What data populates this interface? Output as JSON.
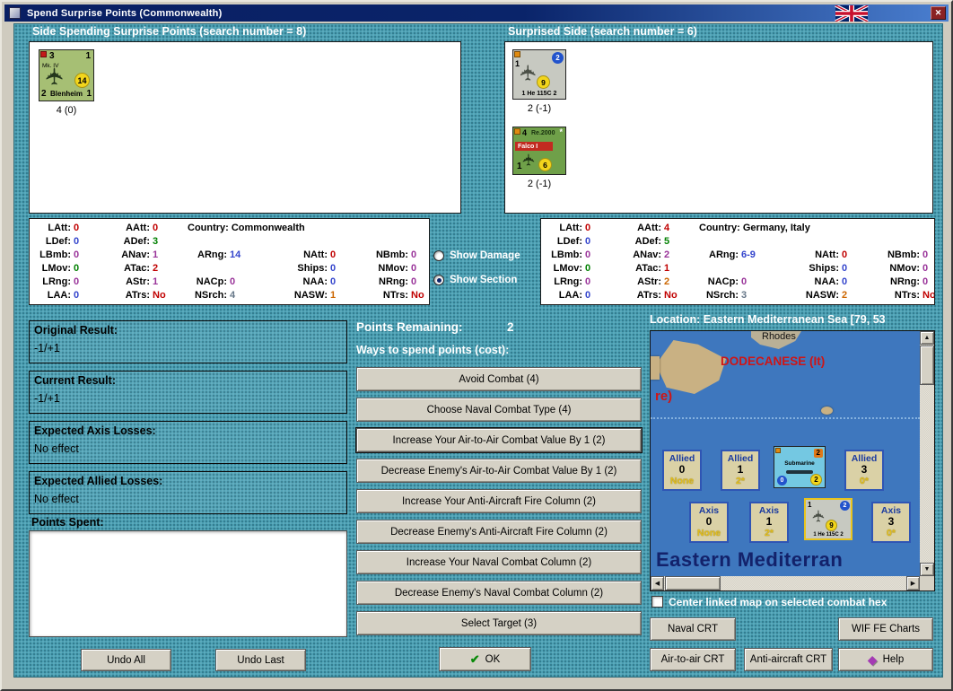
{
  "window": {
    "title": "Spend Surprise Points (Commonwealth)"
  },
  "icons": {
    "close": "✕",
    "up": "▲",
    "down": "▼",
    "left": "◀",
    "right": "▶",
    "check": "✔",
    "help_gem": "◆",
    "plane": "✈"
  },
  "left_panel": {
    "heading": "Side Spending Surprise Points (search number = 8)",
    "counter": {
      "tl": "3",
      "tr": "1",
      "variant": "Mk. IV",
      "rating": "14",
      "bl": "2",
      "name": "Blenheim",
      "br": "1",
      "caption": "4 (0)"
    }
  },
  "right_panel": {
    "heading": "Surprised Side (search number = 6)",
    "he115c": {
      "tl": "1",
      "badge": "2",
      "rating": "9",
      "label": "1 He 115C 2",
      "caption": "2 (-1)"
    },
    "re2000": {
      "tl": "4",
      "name": "Re.2000",
      "star": "*",
      "band": "Falco I",
      "bl": "1",
      "rating": "6",
      "caption": "2 (-1)"
    }
  },
  "spender_stats": {
    "rows": [
      [
        {
          "l": "LAtt:",
          "v": "0",
          "c": "#C00000"
        },
        {
          "l": "AAtt:",
          "v": "0",
          "c": "#C00000"
        },
        {
          "l": "Country:",
          "v": "Commonwealth",
          "c": "#000000",
          "span": 3,
          "country": true
        }
      ],
      [
        {
          "l": "LDef:",
          "v": "0",
          "c": "#3344CC"
        },
        {
          "l": "ADef:",
          "v": "3",
          "c": "#008000"
        },
        null,
        null,
        null
      ],
      [
        {
          "l": "LBmb:",
          "v": "0",
          "c": "#993399"
        },
        {
          "l": "ANav:",
          "v": "1",
          "c": "#993399"
        },
        {
          "l": "ARng:",
          "v": "14",
          "c": "#3344CC"
        },
        {
          "l": "NAtt:",
          "v": "0",
          "c": "#C00000"
        },
        {
          "l": "NBmb:",
          "v": "0",
          "c": "#993399"
        }
      ],
      [
        {
          "l": "LMov:",
          "v": "0",
          "c": "#008000"
        },
        {
          "l": "ATac:",
          "v": "2",
          "c": "#C00000"
        },
        null,
        {
          "l": "Ships:",
          "v": "0",
          "c": "#3344CC"
        },
        {
          "l": "NMov:",
          "v": "0",
          "c": "#993399"
        }
      ],
      [
        {
          "l": "LRng:",
          "v": "0",
          "c": "#993399"
        },
        {
          "l": "AStr:",
          "v": "1",
          "c": "#993399"
        },
        {
          "l": "NACp:",
          "v": "0",
          "c": "#993399"
        },
        {
          "l": "NAA:",
          "v": "0",
          "c": "#3344CC"
        },
        {
          "l": "NRng:",
          "v": "0",
          "c": "#993399"
        }
      ],
      [
        {
          "l": "LAA:",
          "v": "0",
          "c": "#3344CC"
        },
        {
          "l": "ATrs:",
          "v": "No",
          "c": "#C00000"
        },
        {
          "l": "NSrch:",
          "v": "4",
          "c": "#667788"
        },
        {
          "l": "NASW:",
          "v": "1",
          "c": "#CC6600"
        },
        {
          "l": "NTrs:",
          "v": "No",
          "c": "#C00000"
        }
      ]
    ]
  },
  "surprised_stats": {
    "rows": [
      [
        {
          "l": "LAtt:",
          "v": "0",
          "c": "#C00000"
        },
        {
          "l": "AAtt:",
          "v": "4",
          "c": "#C00000"
        },
        {
          "l": "Country:",
          "v": "Germany, Italy",
          "c": "#000000",
          "span": 3,
          "country": true
        }
      ],
      [
        {
          "l": "LDef:",
          "v": "0",
          "c": "#3344CC"
        },
        {
          "l": "ADef:",
          "v": "5",
          "c": "#008000"
        },
        null,
        null,
        null
      ],
      [
        {
          "l": "LBmb:",
          "v": "0",
          "c": "#993399"
        },
        {
          "l": "ANav:",
          "v": "2",
          "c": "#993399"
        },
        {
          "l": "ARng:",
          "v": "6-9",
          "c": "#3344CC"
        },
        {
          "l": "NAtt:",
          "v": "0",
          "c": "#C00000"
        },
        {
          "l": "NBmb:",
          "v": "0",
          "c": "#993399"
        }
      ],
      [
        {
          "l": "LMov:",
          "v": "0",
          "c": "#008000"
        },
        {
          "l": "ATac:",
          "v": "1",
          "c": "#C00000"
        },
        null,
        {
          "l": "Ships:",
          "v": "0",
          "c": "#3344CC"
        },
        {
          "l": "NMov:",
          "v": "0",
          "c": "#993399"
        }
      ],
      [
        {
          "l": "LRng:",
          "v": "0",
          "c": "#993399"
        },
        {
          "l": "AStr:",
          "v": "2",
          "c": "#CC6600"
        },
        {
          "l": "NACp:",
          "v": "0",
          "c": "#993399"
        },
        {
          "l": "NAA:",
          "v": "0",
          "c": "#3344CC"
        },
        {
          "l": "NRng:",
          "v": "0",
          "c": "#993399"
        }
      ],
      [
        {
          "l": "LAA:",
          "v": "0",
          "c": "#3344CC"
        },
        {
          "l": "ATrs:",
          "v": "No",
          "c": "#C00000"
        },
        {
          "l": "NSrch:",
          "v": "3",
          "c": "#667788"
        },
        {
          "l": "NASW:",
          "v": "2",
          "c": "#CC6600"
        },
        {
          "l": "NTrs:",
          "v": "No",
          "c": "#C00000"
        }
      ]
    ]
  },
  "view_options": [
    {
      "label": "Show Damage",
      "selected": false
    },
    {
      "label": "Show Section",
      "selected": true
    }
  ],
  "results": [
    {
      "label": "Original Result:",
      "value": "-1/+1"
    },
    {
      "label": "Current Result:",
      "value": "-1/+1"
    },
    {
      "label": "Expected Axis Losses:",
      "value": "No effect"
    },
    {
      "label": "Expected Allied Losses:",
      "value": "No effect"
    }
  ],
  "points_spent": {
    "label": "Points Spent:",
    "items": []
  },
  "undo": {
    "all": "Undo All",
    "last": "Undo Last"
  },
  "spend": {
    "remaining_label": "Points Remaining:",
    "remaining": "2",
    "ways_label": "Ways to spend points (cost):",
    "options": [
      "Avoid Combat (4)",
      "Choose Naval Combat Type (4)",
      "Increase Your Air-to-Air Combat Value By 1 (2)",
      "Decrease Enemy's Air-to-Air Combat Value By 1 (2)",
      "Increase Your Anti-Aircraft Fire Column (2)",
      "Decrease Enemy's Anti-Aircraft Fire Column (2)",
      "Increase Your Naval Combat Column (2)",
      "Decrease Enemy's Naval Combat Column (2)",
      "Select Target (3)"
    ],
    "focused_index": 2
  },
  "ok_label": "OK",
  "location_label": "Location: Eastern Mediterranean Sea [79, 53",
  "map": {
    "labels": {
      "island": "Rhodes",
      "region": "DODECANESE (It)",
      "partial": "re)",
      "sea_name": "Eastern Mediterran"
    },
    "boxes": [
      {
        "t": "Allied",
        "n": "0",
        "s": "None"
      },
      {
        "t": "Allied",
        "n": "1",
        "s": "2*"
      },
      {
        "t": "Allied",
        "n": "3",
        "s": "0*"
      },
      {
        "t": "Axis",
        "n": "0",
        "s": "None"
      },
      {
        "t": "Axis",
        "n": "1",
        "s": "2*"
      },
      {
        "t": "Axis",
        "n": "3",
        "s": "0*"
      }
    ],
    "submarine_counter": {
      "tr": "2",
      "name": "Submarine",
      "bl": "0",
      "br": "2"
    },
    "he115c_counter": {
      "tl": "1",
      "badge": "2",
      "rating": "9",
      "label": "1 He 115C 2"
    },
    "checkbox_label": "Center linked map on selected combat hex",
    "checkbox_checked": false
  },
  "crt_buttons": {
    "naval": "Naval CRT",
    "wif_fe": "WIF FE Charts",
    "air": "Air-to-air CRT",
    "aa": "Anti-aircraft CRT",
    "help": "Help"
  },
  "colors": {
    "teal_bg": "#4BA1B5",
    "titlebar_from": "#0A246A",
    "titlebar_to": "#4A7FD0",
    "sea": "#3E77BE",
    "land": "#C9B183",
    "counter_green": "#A6BF74",
    "counter_gray": "#C7C9C1",
    "counter_dark_green": "#6FA049",
    "selected_highlight": "#E8C41E"
  }
}
